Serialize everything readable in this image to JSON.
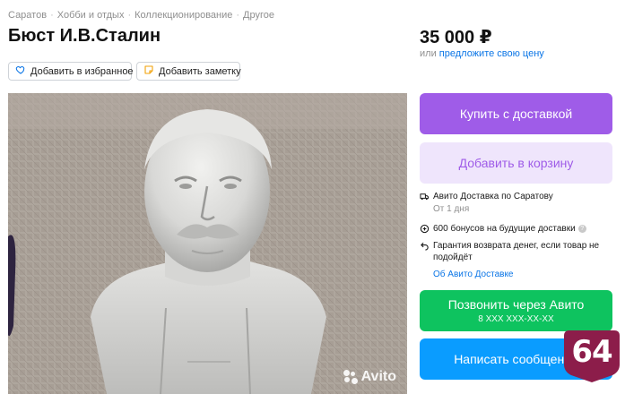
{
  "breadcrumbs": [
    "Саратов",
    "Хобби и отдых",
    "Коллекционирование",
    "Другое"
  ],
  "breadcrumb_separator": "·",
  "title": "Бюст И.В.Сталин",
  "price": {
    "value": "35 000 ₽",
    "prefix": "или",
    "offer_link": "предложите свою цену"
  },
  "actions": {
    "favorite_label": "Добавить в избранное",
    "note_label": "Добавить заметку"
  },
  "photo": {
    "watermark": "Avito"
  },
  "cta": {
    "buy_label": "Купить с доставкой",
    "cart_label": "Добавить в корзину",
    "call_label": "Позвонить через Авито",
    "call_phone": "8 XXX XXX-XX-XX",
    "message_label": "Написать сообщение"
  },
  "delivery": {
    "line1": "Авито Доставка по Саратову",
    "line1_sub": "От 1 дня",
    "line2": "600 бонусов на будущие доставки",
    "line3": "Гарантия возврата денег, если товар не подойдёт",
    "link": "Об Авито Доставке"
  },
  "overlay_badge": "64",
  "colors": {
    "buy": "#9f5ce8",
    "cart_bg": "#efe5fc",
    "call": "#0ec35f",
    "message": "#0a9cff",
    "link": "#0a75e6",
    "badge": "#8c1d4a"
  }
}
